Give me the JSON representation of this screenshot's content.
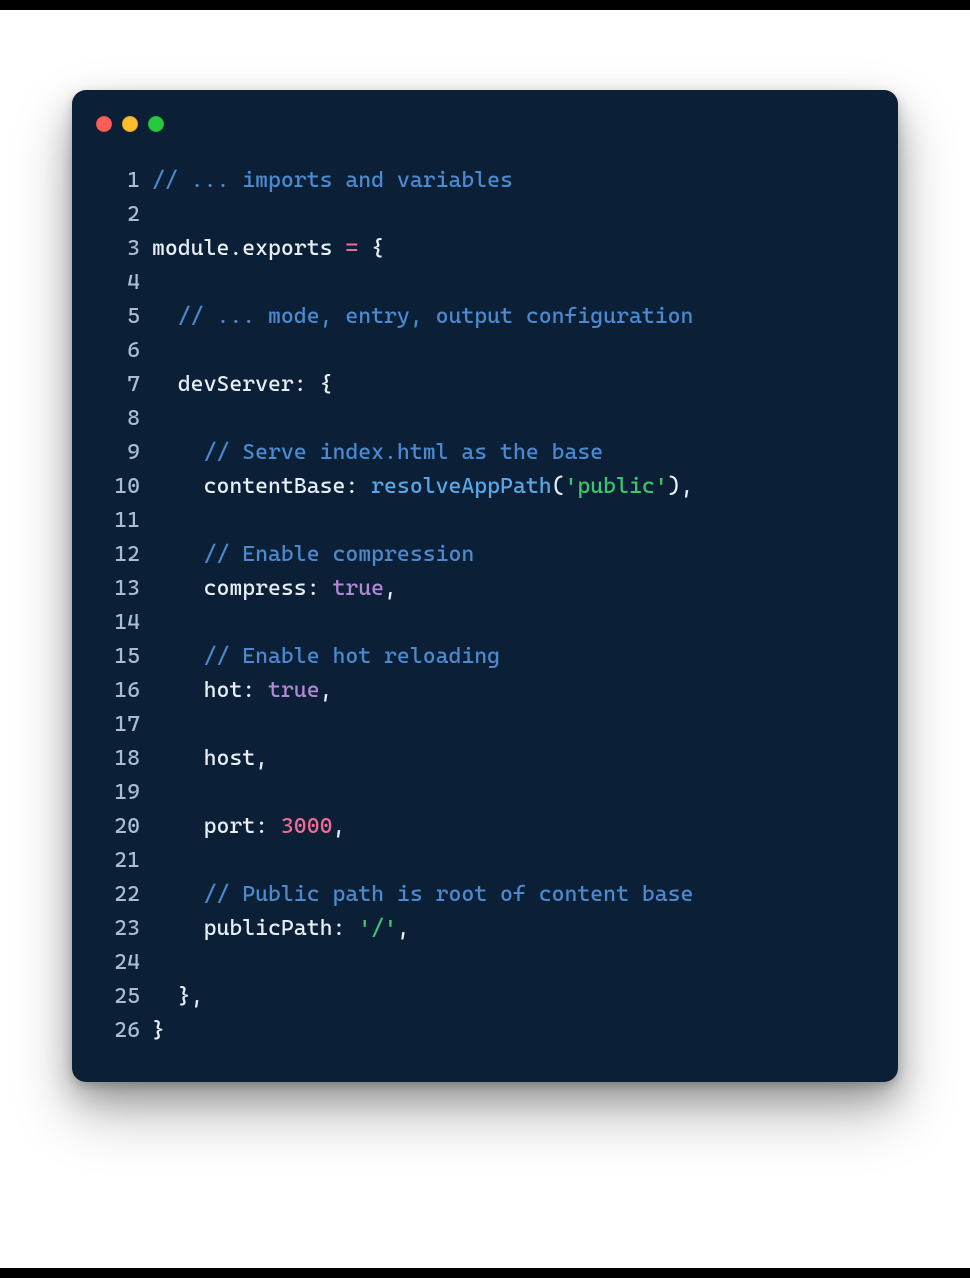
{
  "window": {
    "dots": {
      "red": "close-dot",
      "yellow": "minimize-dot",
      "green": "zoom-dot"
    }
  },
  "code": {
    "lineNumbers": [
      "1",
      "2",
      "3",
      "4",
      "5",
      "6",
      "7",
      "8",
      "9",
      "10",
      "11",
      "12",
      "13",
      "14",
      "15",
      "16",
      "17",
      "18",
      "19",
      "20",
      "21",
      "22",
      "23",
      "24",
      "25",
      "26"
    ],
    "lines": {
      "l1": {
        "comment": "// ... imports and variables"
      },
      "l3": {
        "module": "module",
        "dot": ".",
        "exports": "exports",
        "space": " ",
        "eq": "=",
        "space2": " ",
        "brace": "{"
      },
      "l5": {
        "indent": "  ",
        "comment": "// ... mode, entry, output configuration"
      },
      "l7": {
        "indent": "  ",
        "key": "devServer",
        "colon": ":",
        "space": " ",
        "brace": "{"
      },
      "l9": {
        "indent": "    ",
        "comment": "// Serve index.html as the base"
      },
      "l10": {
        "indent": "    ",
        "key": "contentBase",
        "colon": ":",
        "space": " ",
        "func": "resolveAppPath",
        "lpar": "(",
        "str": "'public'",
        "rpar": ")",
        "comma": ","
      },
      "l12": {
        "indent": "    ",
        "comment": "// Enable compression"
      },
      "l13": {
        "indent": "    ",
        "key": "compress",
        "colon": ":",
        "space": " ",
        "kw": "true",
        "comma": ","
      },
      "l15": {
        "indent": "    ",
        "comment": "// Enable hot reloading"
      },
      "l16": {
        "indent": "    ",
        "key": "hot",
        "colon": ":",
        "space": " ",
        "kw": "true",
        "comma": ","
      },
      "l18": {
        "indent": "    ",
        "key": "host",
        "comma": ","
      },
      "l20": {
        "indent": "    ",
        "key": "port",
        "colon": ":",
        "space": " ",
        "num": "3000",
        "comma": ","
      },
      "l22": {
        "indent": "    ",
        "comment": "// Public path is root of content base"
      },
      "l23": {
        "indent": "    ",
        "key": "publicPath",
        "colon": ":",
        "space": " ",
        "str": "'/'",
        "comma": ","
      },
      "l25": {
        "indent": "  ",
        "brace": "}",
        "comma": ","
      },
      "l26": {
        "brace": "}"
      }
    }
  }
}
